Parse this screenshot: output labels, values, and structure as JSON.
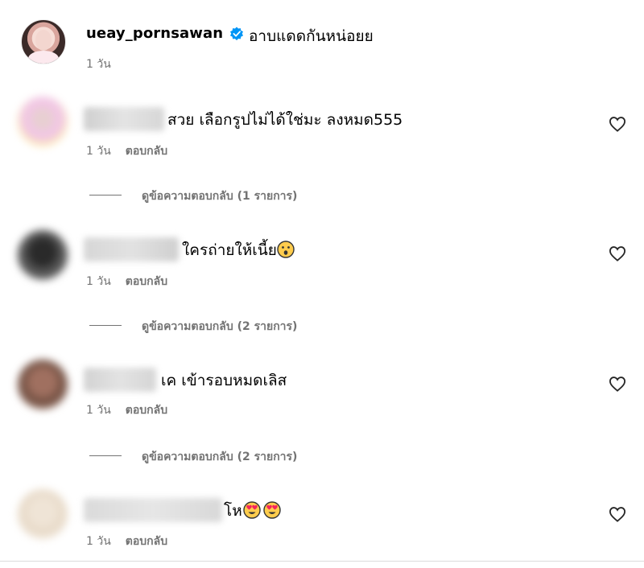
{
  "post": {
    "username": "ueay_pornsawan",
    "caption": "อาบแดดกันหน่อยย",
    "time": "1 วัน"
  },
  "comments": [
    {
      "text": "สวย เลือกรูปไม่ได้ใช่มะ ลงหมด555",
      "time": "1 วัน",
      "reply_label": "ตอบกลับ",
      "view_replies": "ดูข้อความตอบกลับ (1 รายการ)"
    },
    {
      "text": "ใครถ่ายให้เนี้ย",
      "emoji": "hushed-face",
      "time": "1 วัน",
      "reply_label": "ตอบกลับ",
      "view_replies": "ดูข้อความตอบกลับ (2 รายการ)"
    },
    {
      "text": "เค เข้ารอบหมดเลิส",
      "time": "1 วัน",
      "reply_label": "ตอบกลับ",
      "view_replies": "ดูข้อความตอบกลับ (2 รายการ)"
    },
    {
      "text": "โห",
      "emoji": "heart-eyes-face",
      "time": "1 วัน",
      "reply_label": "ตอบกลับ"
    }
  ],
  "colors": {
    "verified": "#0095f6",
    "secondary_text": "#737373",
    "emoji_yellow": "#ffcc4d",
    "emoji_heart": "#f4245e"
  }
}
